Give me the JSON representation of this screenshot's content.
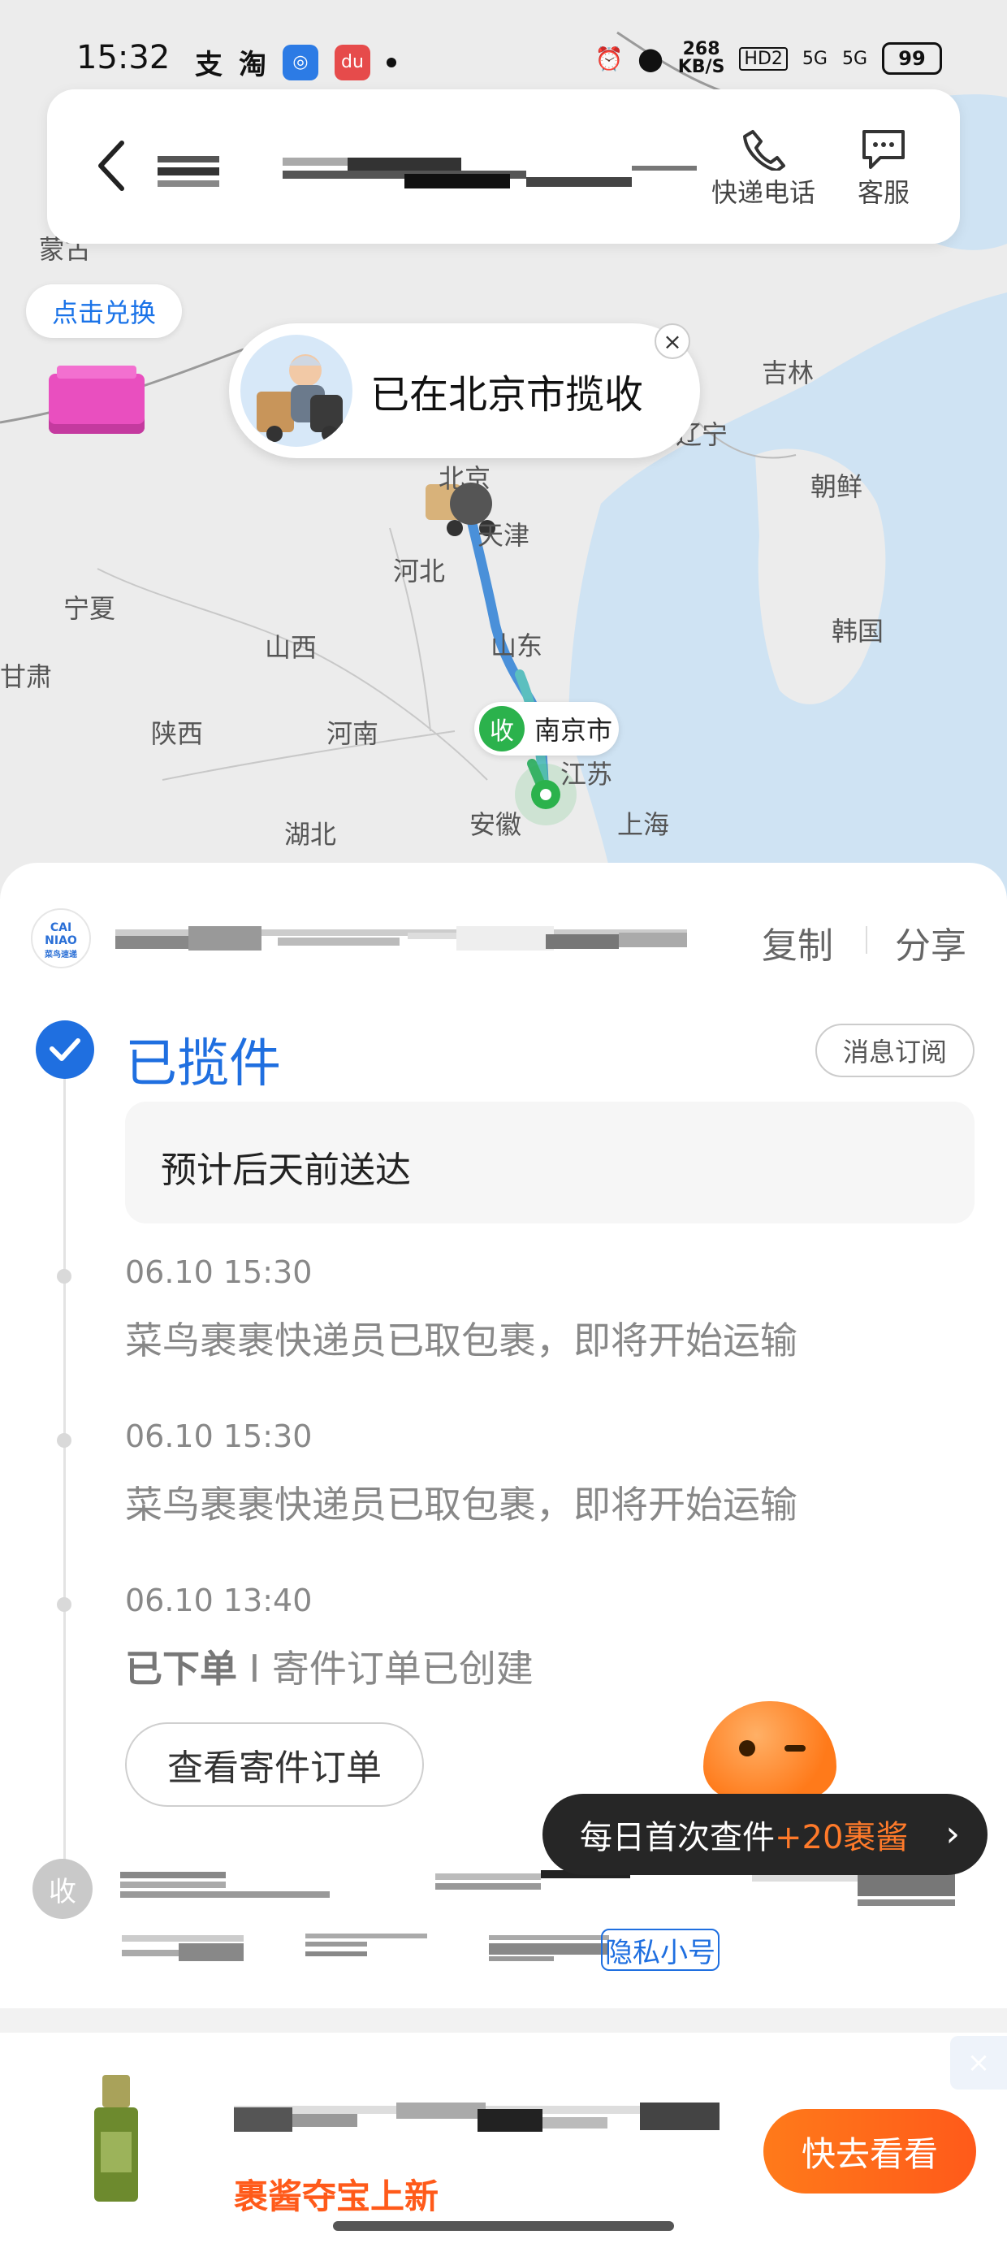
{
  "status_bar": {
    "time": "15:32",
    "apps": [
      "支",
      "淘"
    ],
    "net_speed_value": "268",
    "net_speed_unit": "KB/S",
    "hd_label": "HD2",
    "signal_1": "5G",
    "signal_2": "5G",
    "battery": "99"
  },
  "header": {
    "courier_phone_label": "快递电话",
    "service_label": "客服"
  },
  "map": {
    "labels": {
      "menggu": "蒙古",
      "jilin": "吉林",
      "liaoning": "辽宁",
      "beijing": "北京",
      "tianjin": "天津",
      "hebei": "河北",
      "chaoxian": "朝鲜",
      "ningxia": "宁夏",
      "shanxi": "山西",
      "shandong": "山东",
      "hanguo": "韩国",
      "gansu": "甘肃",
      "shaanxi": "陕西",
      "henan": "河南",
      "jiangsu": "江苏",
      "hubei": "湖北",
      "anhui": "安徽",
      "shanghai": "上海"
    },
    "redeem_label": "点击兑换",
    "pickup_bubble_text": "已在北京市揽收",
    "close_symbol": "×",
    "destination_badge": "收",
    "destination_city": "南京市"
  },
  "package": {
    "logo_text": "CAI NIAO 菜鸟速递",
    "copy_label": "复制",
    "share_label": "分享",
    "status_title": "已揽件",
    "subscribe_label": "消息订阅",
    "eta_text": "预计后天前送达",
    "events": [
      {
        "time": "06.10 15:30",
        "text": "菜鸟裹裹快递员已取包裹，即将开始运输"
      },
      {
        "time": "06.10 15:30",
        "text": "菜鸟裹裹快递员已取包裹，即将开始运输"
      },
      {
        "time": "06.10 13:40",
        "bold": "已下单",
        "sep": " I ",
        "text": "寄件订单已创建"
      }
    ],
    "view_order_label": "查看寄件订单",
    "receiver_badge": "收",
    "privacy_label": "隐私小号"
  },
  "promo": {
    "prefix": "每日首次查件",
    "highlight": "+20裹酱",
    "chevron": "›"
  },
  "ad": {
    "subtitle": "裹酱夺宝上新",
    "cta_label": "快去看看",
    "close_symbol": "×"
  }
}
